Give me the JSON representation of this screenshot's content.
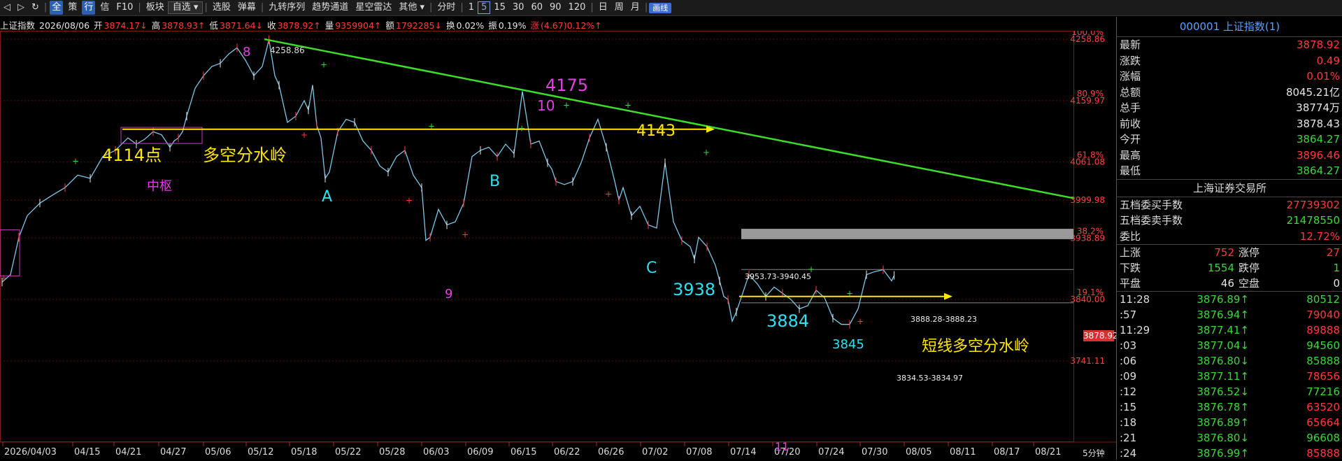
{
  "toolbar": {
    "items": [
      "全",
      "策",
      "行",
      "信",
      "F10",
      "板块",
      "自选",
      "选股",
      "弹幕",
      "九转序列",
      "趋势通道",
      "星空雷达",
      "其他",
      "分时",
      "1",
      "5",
      "15",
      "30",
      "60",
      "90",
      "120",
      "日",
      "周",
      "月",
      "画线"
    ]
  },
  "infobar": {
    "name": "上证指数",
    "date": "2026/08/06",
    "open_label": "开",
    "open": "3874.17↓",
    "high_label": "高",
    "high": "3878.93↑",
    "low_label": "低",
    "low": "3871.64↓",
    "close_label": "收",
    "close": "3878.92↑",
    "vol_label": "量",
    "vol": "9359904↑",
    "amt_label": "额",
    "amt": "1792285↓",
    "turn_label": "换",
    "turn": "0.02%",
    "amp_label": "振",
    "amp": "0.19%",
    "chg_label": "涨",
    "chg": "(4.67)0.12%↑"
  },
  "chart_data": {
    "type": "line",
    "period": "5分钟",
    "x_ticks": [
      "2026/04/03",
      "04/15",
      "04/21",
      "04/27",
      "05/06",
      "05/12",
      "05/18",
      "05/22",
      "05/28",
      "06/03",
      "06/09",
      "06/15",
      "06/22",
      "06/26",
      "07/02",
      "07/08",
      "07/14",
      "07/20",
      "07/24",
      "07/30",
      "08/05",
      "08/11",
      "08/17",
      "08/21"
    ],
    "y_ticks": [
      {
        "price": 4258.86,
        "pct": "100.0%"
      },
      {
        "price": 4159.97,
        "pct": "80.9%"
      },
      {
        "price": 4061.08,
        "pct": "61.8%"
      },
      {
        "price": 3999.98,
        "pct": ""
      },
      {
        "price": 3938.89,
        "pct": "38.2%"
      },
      {
        "price": 3840.0,
        "pct": "19.1%"
      },
      {
        "price": 3741.11,
        "pct": ""
      }
    ],
    "ylim": [
      3741.11,
      4270
    ],
    "last_price": "3878.92",
    "series": [
      {
        "x": [
          0,
          10,
          20,
          30,
          45,
          60,
          75,
          90,
          105,
          120,
          135,
          150,
          160,
          170,
          180,
          190,
          200,
          205,
          210,
          215,
          220,
          230,
          240,
          250,
          260,
          270,
          280,
          290,
          300,
          310,
          318,
          325,
          330,
          340,
          350,
          360,
          365,
          370,
          375,
          380,
          385,
          390,
          400,
          410,
          420,
          430,
          440,
          450,
          460,
          470,
          480,
          490,
          500,
          505,
          510,
          520,
          530,
          540,
          550,
          560,
          570,
          580,
          590,
          600,
          610,
          620,
          630,
          640,
          650,
          655,
          660,
          670,
          680,
          690,
          700,
          710,
          720,
          730,
          735,
          740,
          750,
          760,
          770,
          780,
          790,
          800,
          810,
          820,
          825,
          830,
          840,
          850,
          855,
          860,
          865,
          870,
          875,
          880,
          890,
          900,
          910,
          920,
          930,
          940,
          950,
          960,
          970,
          980,
          990,
          1000,
          1010,
          1020,
          1030,
          1040,
          1050,
          1060,
          1063
        ],
        "values": [
          3868,
          3880,
          3940,
          3975,
          3995,
          4008,
          4020,
          4040,
          4035,
          4070,
          4080,
          4100,
          4090,
          4098,
          4110,
          4105,
          4085,
          4095,
          4100,
          4110,
          4135,
          4180,
          4200,
          4215,
          4220,
          4235,
          4245,
          4225,
          4200,
          4215,
          4258,
          4200,
          4185,
          4125,
          4135,
          4160,
          4145,
          4185,
          4120,
          4100,
          4035,
          4045,
          4110,
          4130,
          4125,
          4095,
          4080,
          4055,
          4045,
          4070,
          4080,
          4040,
          4020,
          3935,
          3940,
          3985,
          3960,
          3965,
          3995,
          4070,
          4080,
          4085,
          4070,
          4090,
          4075,
          4175,
          4090,
          4095,
          4060,
          4050,
          4030,
          4025,
          4030,
          4060,
          4100,
          4130,
          4085,
          4030,
          4000,
          4020,
          3975,
          3990,
          3960,
          3955,
          4060,
          3965,
          3935,
          3925,
          3905,
          3940,
          3925,
          3895,
          3870,
          3845,
          3840,
          3805,
          3820,
          3840,
          3880,
          3865,
          3845,
          3860,
          3850,
          3840,
          3825,
          3830,
          3855,
          3843,
          3810,
          3800,
          3800,
          3825,
          3880,
          3885,
          3888,
          3870,
          3878.92
        ]
      }
    ],
    "annotations": {
      "peak_price": "4258.86",
      "label_8": "8",
      "label_4175": "4175",
      "label_10": "10",
      "label_4143": "4143",
      "label_4114": "4114点",
      "label_watershed": "多空分水岭",
      "label_center": "中枢",
      "label_A": "A",
      "label_B": "B",
      "label_C": "C",
      "label_9": "9",
      "label_3938": "3938",
      "gap_range": "3953.73-3940.45",
      "label_3884": "3884",
      "label_3845": "3845",
      "short_watershed": "短线多空分水岭",
      "upper_range": "3888.28-3888.23",
      "lower_range": "3834.53-3834.97",
      "label_11": "11"
    }
  },
  "panel": {
    "title": "000001 上证指数(1)",
    "quote": [
      {
        "k": "最新",
        "v": "3878.92",
        "c": "red"
      },
      {
        "k": "涨跌",
        "v": "0.49",
        "c": "red"
      },
      {
        "k": "涨幅",
        "v": "0.01%",
        "c": "red"
      },
      {
        "k": "总额",
        "v": "8045.21亿",
        "c": "white"
      },
      {
        "k": "总手",
        "v": "38774万",
        "c": "white"
      },
      {
        "k": "前收",
        "v": "3878.43",
        "c": "white"
      },
      {
        "k": "今开",
        "v": "3864.27",
        "c": "green"
      },
      {
        "k": "最高",
        "v": "3896.46",
        "c": "red"
      },
      {
        "k": "最低",
        "v": "3864.27",
        "c": "green"
      }
    ],
    "exchange": "上海证券交易所",
    "orders": [
      {
        "k": "五档委买手数",
        "v": "27739302",
        "c": "red"
      },
      {
        "k": "五档委卖手数",
        "v": "21478550",
        "c": "green"
      },
      {
        "k": "委比",
        "v": "12.72%",
        "c": "red"
      }
    ],
    "breadth": [
      {
        "a": "上涨",
        "b": "752",
        "bc": "red",
        "c": "涨停",
        "d": "27",
        "dc": "red"
      },
      {
        "a": "下跌",
        "b": "1554",
        "bc": "green",
        "c": "跌停",
        "d": "1",
        "dc": "green"
      },
      {
        "a": "平盘",
        "b": "46",
        "bc": "white",
        "c": "空盘",
        "d": "0",
        "dc": "white"
      }
    ],
    "ticks": [
      {
        "t": "11:28",
        "p": "3876.89↑",
        "pc": "green",
        "v": "80512",
        "vc": "green"
      },
      {
        "t": ":57",
        "p": "3876.94↑",
        "pc": "green",
        "v": "79040",
        "vc": "red"
      },
      {
        "t": "11:29",
        "p": "3877.41↑",
        "pc": "green",
        "v": "89888",
        "vc": "red"
      },
      {
        "t": ":03",
        "p": "3877.04↓",
        "pc": "green",
        "v": "94560",
        "vc": "green"
      },
      {
        "t": ":06",
        "p": "3876.80↓",
        "pc": "green",
        "v": "85888",
        "vc": "green"
      },
      {
        "t": ":09",
        "p": "3877.11↑",
        "pc": "green",
        "v": "78656",
        "vc": "red"
      },
      {
        "t": ":12",
        "p": "3876.52↓",
        "pc": "green",
        "v": "77216",
        "vc": "green"
      },
      {
        "t": ":15",
        "p": "3876.78↑",
        "pc": "green",
        "v": "63520",
        "vc": "red"
      },
      {
        "t": ":18",
        "p": "3876.89↑",
        "pc": "green",
        "v": "65664",
        "vc": "red"
      },
      {
        "t": ":21",
        "p": "3876.80↓",
        "pc": "green",
        "v": "96608",
        "vc": "green"
      },
      {
        "t": ":24",
        "p": "3876.99↑",
        "pc": "green",
        "v": "85888",
        "vc": "red"
      }
    ]
  },
  "colors": {
    "up": "#ff3a3a",
    "down": "#3dd63d",
    "trend": "#3ddc2a",
    "watershed": "#ffe600",
    "magenta": "#e040e0",
    "cyan": "#2ee0f0",
    "grid": "#5a1010"
  }
}
